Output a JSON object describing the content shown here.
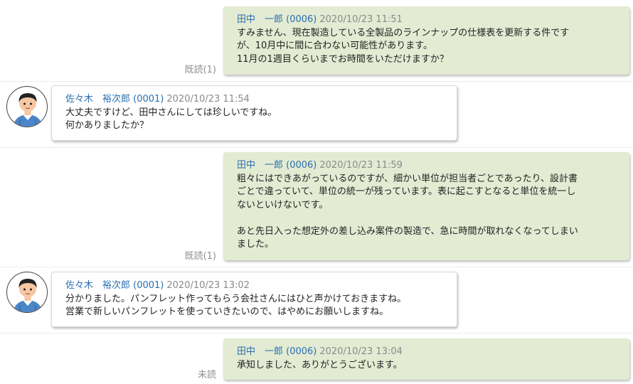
{
  "messages": [
    {
      "direction": "out",
      "sender": "田中　一郎 (0006)",
      "time": "2020/10/23 11:51",
      "lines": [
        "すみません、現在製造している全製品のラインナップの仕様表を更新する件です",
        "が、10月中に間に合わない可能性があります。",
        "11月の1週目くらいまでお時間をいただけますか？"
      ],
      "status": "既読(1)"
    },
    {
      "direction": "in",
      "sender": "佐々木　裕次郎 (0001)",
      "time": "2020/10/23 11:54",
      "lines": [
        "大丈夫ですけど、田中さんにしては珍しいですね。",
        "何かありましたか？"
      ]
    },
    {
      "direction": "out",
      "sender": "田中　一郎 (0006)",
      "time": "2020/10/23 11:59",
      "lines": [
        "粗々にはできあがっているのですが、細かい単位が担当者ごとであったり、設計書",
        "ごとで違っていて、単位の統一が残っています。表に起こすとなると単位を統一し",
        "ないといけないです。",
        "",
        "あと先日入った想定外の差し込み案件の製造で、急に時間が取れなくなってしまい",
        "ました。"
      ],
      "status": "既読(1)"
    },
    {
      "direction": "in",
      "sender": "佐々木　裕次郎 (0001)",
      "time": "2020/10/23 13:02",
      "lines": [
        "分かりました。パンフレット作ってもらう会社さんにはひと声かけておきますね。",
        "営業で新しいパンフレットを使っていきたいので、はやめにお願いしますね。"
      ]
    },
    {
      "direction": "out",
      "sender": "田中　一郎 (0006)",
      "time": "2020/10/23 13:04",
      "lines": [
        "承知しました、ありがとうございます。"
      ],
      "status": "未読"
    }
  ],
  "avatar_icon": "person-avatar-icon"
}
